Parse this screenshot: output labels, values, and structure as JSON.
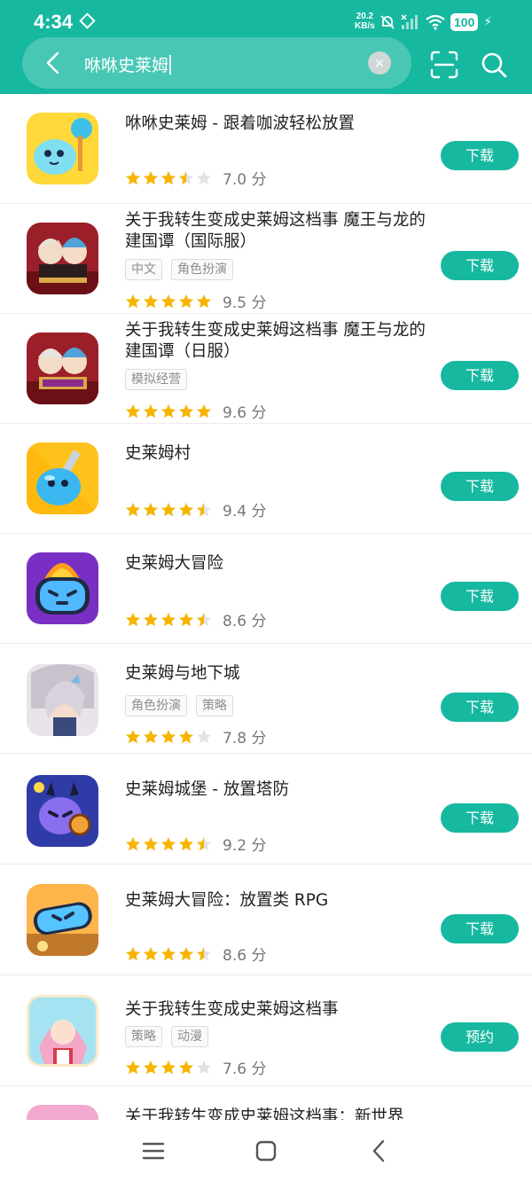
{
  "status_bar": {
    "time": "4:34",
    "net_speed_value": "20.2",
    "net_speed_unit": "KB/s",
    "battery": "100"
  },
  "search": {
    "query": "咻咻史莱姆",
    "clear_symbol": "×"
  },
  "colors": {
    "accent": "#16b8a0",
    "star_filled": "#f7b500",
    "star_empty": "#e2e2e2"
  },
  "apps": [
    {
      "title": "咻咻史莱姆 - 跟着咖波轻松放置",
      "tags": [],
      "rating": 3.5,
      "score": "7.0 分",
      "action": "下载",
      "icon": "blue-slime-game-icon"
    },
    {
      "title": "关于我转生变成史莱姆这档事 魔王与龙的建国谭（国际服）",
      "tags": [
        "中文",
        "角色扮演"
      ],
      "rating": 5,
      "score": "9.5 分",
      "action": "下载",
      "icon": "anime-event-game-icon"
    },
    {
      "title": "关于我转生变成史莱姆这档事 魔王与龙的建国谭（日服）",
      "tags": [
        "模拟经营"
      ],
      "rating": 5,
      "score": "9.6 分",
      "action": "下载",
      "icon": "anime-event-jp-game-icon"
    },
    {
      "title": "史莱姆村",
      "tags": [],
      "rating": 4.5,
      "score": "9.4 分",
      "action": "下载",
      "icon": "slime-village-game-icon"
    },
    {
      "title": "史莱姆大冒险",
      "tags": [],
      "rating": 4.5,
      "score": "8.6 分",
      "action": "下载",
      "icon": "slime-adventure-game-icon"
    },
    {
      "title": "史莱姆与地下城",
      "tags": [
        "角色扮演",
        "策略"
      ],
      "rating": 4,
      "score": "7.8 分",
      "action": "下载",
      "icon": "slime-dungeon-game-icon"
    },
    {
      "title": "史莱姆城堡 - 放置塔防",
      "tags": [],
      "rating": 4.5,
      "score": "9.2 分",
      "action": "下载",
      "icon": "slime-castle-game-icon"
    },
    {
      "title": "史莱姆大冒险：放置类 RPG",
      "tags": [],
      "rating": 4.5,
      "score": "8.6 分",
      "action": "下载",
      "icon": "slime-adventure-rpg-game-icon"
    },
    {
      "title": "关于我转生变成史莱姆这档事",
      "tags": [
        "策略",
        "动漫"
      ],
      "rating": 4,
      "score": "7.6 分",
      "action": "预约",
      "icon": "anime-girl-game-icon"
    },
    {
      "title": "关于我转生变成史莱姆这档事：新世界",
      "tags": [],
      "rating": 0,
      "score": "",
      "action": "",
      "icon": "new-world-game-icon"
    }
  ]
}
